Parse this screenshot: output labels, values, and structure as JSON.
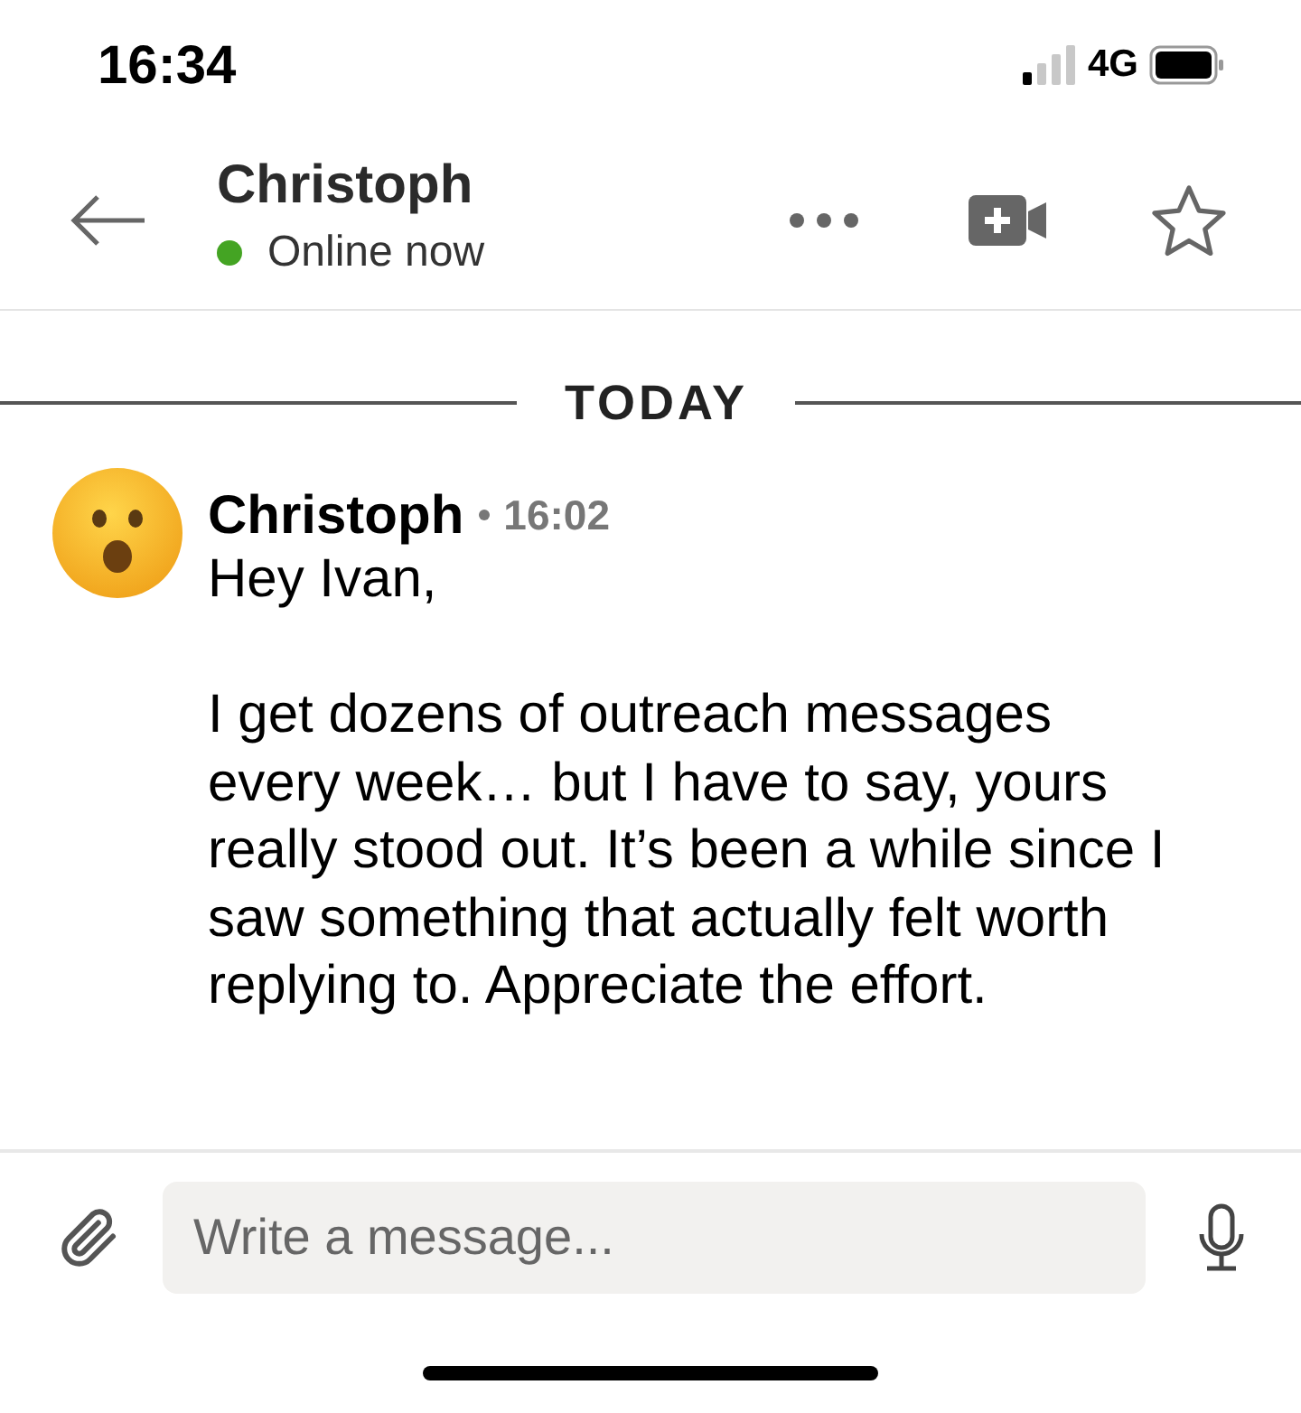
{
  "status_bar": {
    "time": "16:34",
    "network": "4G"
  },
  "header": {
    "name": "Christoph",
    "status": "Online now",
    "online": true
  },
  "date_divider": "TODAY",
  "messages": [
    {
      "sender": "Christoph",
      "time": "16:02",
      "paragraphs": [
        "Hey Ivan,",
        "I get dozens of outreach messages every week… but I have to say, yours really stood out. It’s been a while since I saw something that actually felt worth replying to. Appreciate the effort."
      ]
    }
  ],
  "composer": {
    "placeholder": "Write a message..."
  }
}
